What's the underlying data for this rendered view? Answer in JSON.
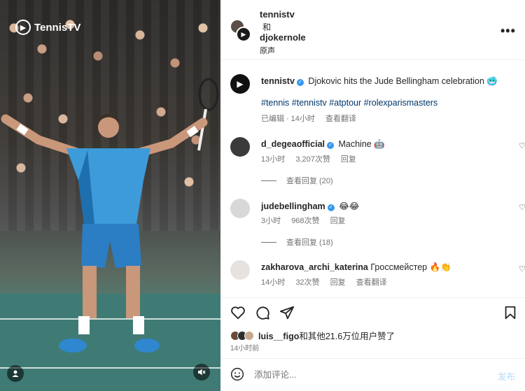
{
  "media": {
    "logo_text": "TennisTV",
    "logo_mark": "tv",
    "user_icon": "user-icon",
    "mute_icon": "volume-muted-icon"
  },
  "header": {
    "user1": "tennistv",
    "and_text": "和",
    "user2": "djokernole",
    "audio": "原声",
    "more": "•••"
  },
  "caption": {
    "username": "tennistv",
    "text": "Djokovic hits the Jude Bellingham celebration 🥶",
    "hashtags": "#tennis #tennistv #atptour #rolexparismasters",
    "edited": "已编辑",
    "dot": "·",
    "time": "14小时",
    "translate": "查看翻译"
  },
  "comments": [
    {
      "username": "d_degeaofficial",
      "verified": true,
      "text": "Machine 🤖",
      "time": "13小时",
      "likes": "3,207次赞",
      "reply": "回复",
      "view_replies": "查看回复 (20)",
      "avatar_color": "#3b3b3b"
    },
    {
      "username": "judebellingham",
      "verified": true,
      "text": "😂😂",
      "time": "3小时",
      "likes": "968次赞",
      "reply": "回复",
      "view_replies": "查看回复 (18)",
      "avatar_color": "#d8d8d8"
    },
    {
      "username": "zakharova_archi_katerina",
      "verified": false,
      "text": "Гроссмейстер 🔥👏",
      "time": "14小时",
      "likes": "32次赞",
      "reply": "回复",
      "translate": "查看翻译",
      "avatar_color": "#e6e3df"
    }
  ],
  "actions": {
    "like_icon": "heart-icon",
    "comment_icon": "comment-icon",
    "share_icon": "send-icon",
    "save_icon": "bookmark-icon"
  },
  "likes": {
    "first_user": "luis__figo",
    "rest": "和其他21.6万位用户赞了",
    "time_ago": "14小时前",
    "avatar_colors": [
      "#6b4a3a",
      "#2e2e2e",
      "#c9a98e"
    ]
  },
  "comment_box": {
    "placeholder": "添加评论...",
    "post_label": "发布"
  }
}
